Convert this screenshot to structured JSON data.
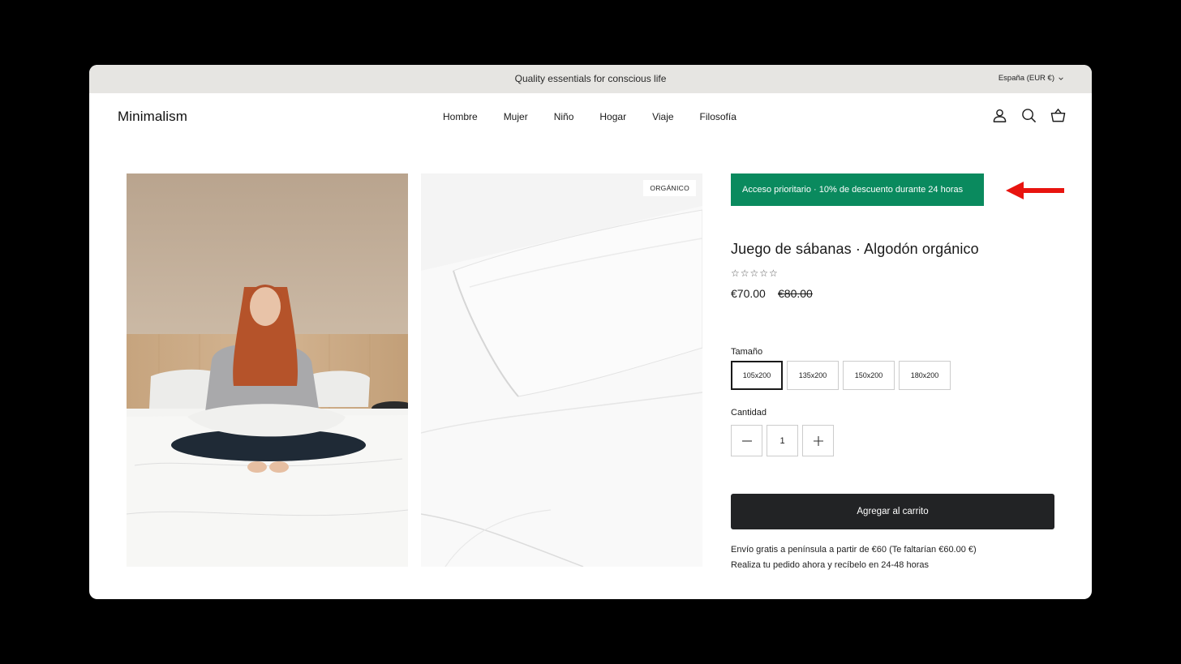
{
  "announcement": {
    "text": "Quality essentials for conscious life"
  },
  "region": {
    "label": "España (EUR €)"
  },
  "header": {
    "logo": "Minimalism",
    "nav": [
      "Hombre",
      "Mujer",
      "Niño",
      "Hogar",
      "Viaje",
      "Filosofía"
    ],
    "icons": [
      "account-icon",
      "search-icon",
      "basket-icon"
    ]
  },
  "gallery": {
    "badge": "ORGÁNICO"
  },
  "product": {
    "promo": "Acceso prioritario · 10% de descuento durante 24 horas",
    "title": "Juego de sábanas · Algodón orgánico",
    "rating_stars": "☆☆☆☆☆",
    "rating": 0,
    "price": "€70.00",
    "compare_price": "€80.00",
    "size_label": "Tamaño",
    "sizes": [
      "105x200",
      "135x200",
      "150x200",
      "180x200"
    ],
    "selected_size": "105x200",
    "quantity_label": "Cantidad",
    "quantity": "1",
    "add_to_cart": "Agregar al carrito",
    "shipping_line1": "Envío gratis a península a partir de €60 (Te faltarían €60.00 €)",
    "shipping_line2": "Realiza tu pedido ahora y recíbelo en 24-48 horas"
  },
  "colors": {
    "promo_bg": "#0a8a5e",
    "cart_bg": "#222325",
    "annotation_arrow": "#e8140f"
  }
}
